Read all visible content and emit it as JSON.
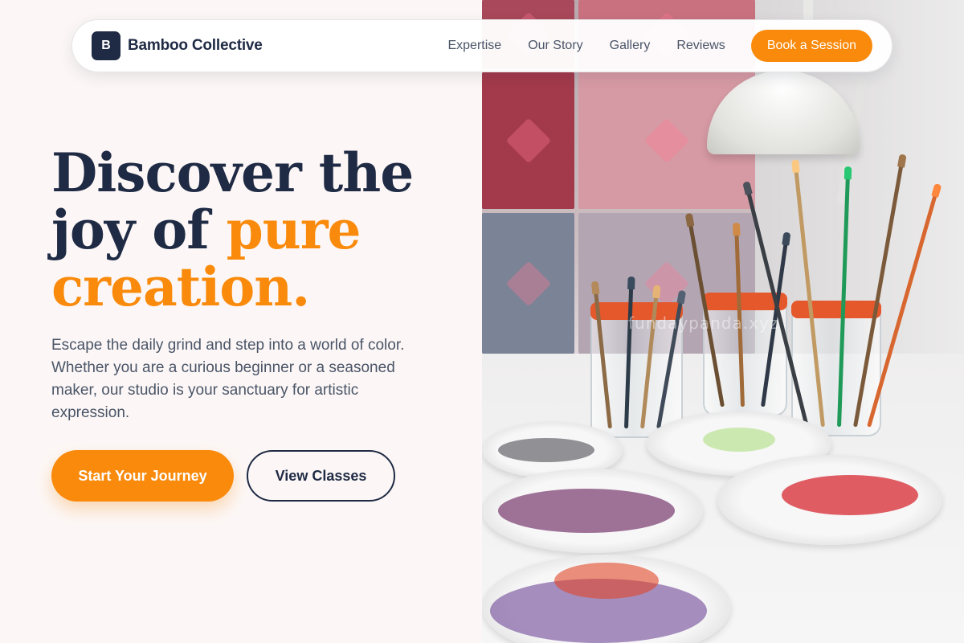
{
  "brand": {
    "initial": "B",
    "name": "Bamboo Collective"
  },
  "nav": {
    "links": [
      "Expertise",
      "Our Story",
      "Gallery",
      "Reviews"
    ],
    "cta_label": "Book a Session"
  },
  "hero": {
    "headline_part1": "Discover the joy of ",
    "headline_accent": "pure creation.",
    "subtext": "Escape the daily grind and step into a world of color. Whether you are a curious beginner or a seasoned maker, our studio is your sanctuary for artistic expression.",
    "primary_label": "Start Your Journey",
    "secondary_label": "View Classes"
  },
  "image": {
    "watermark": "fundaypanda.xyz"
  },
  "colors": {
    "accent": "#f98a0c",
    "navy": "#1f2a44",
    "background": "#fcf7f6"
  }
}
